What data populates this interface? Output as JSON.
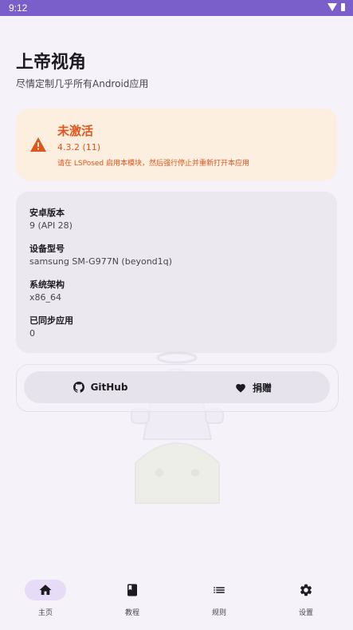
{
  "status_bar": {
    "time": "9:12"
  },
  "header": {
    "title": "上帝视角",
    "subtitle": "尽情定制几乎所有Android应用"
  },
  "warning_card": {
    "title": "未激活",
    "version": "4.3.2 (11)",
    "message": "请在 LSPosed 启用本模块，然后强行停止并重新打开本应用"
  },
  "info_card": {
    "items": [
      {
        "label": "安卓版本",
        "value": "9 (API 28)"
      },
      {
        "label": "设备型号",
        "value": "samsung SM-G977N (beyond1q)"
      },
      {
        "label": "系统架构",
        "value": "x86_64"
      },
      {
        "label": "已同步应用",
        "value": "0"
      }
    ]
  },
  "actions": {
    "github_label": "GitHub",
    "donate_label": "捐赠"
  },
  "bottom_nav": {
    "items": [
      {
        "label": "主页",
        "icon": "home-icon",
        "active": true
      },
      {
        "label": "教程",
        "icon": "book-icon",
        "active": false
      },
      {
        "label": "规则",
        "icon": "list-icon",
        "active": false
      },
      {
        "label": "设置",
        "icon": "gear-icon",
        "active": false
      }
    ]
  },
  "colors": {
    "accent": "#7a5ec9",
    "warning": "#e2541a",
    "background": "#f5f2fa"
  }
}
